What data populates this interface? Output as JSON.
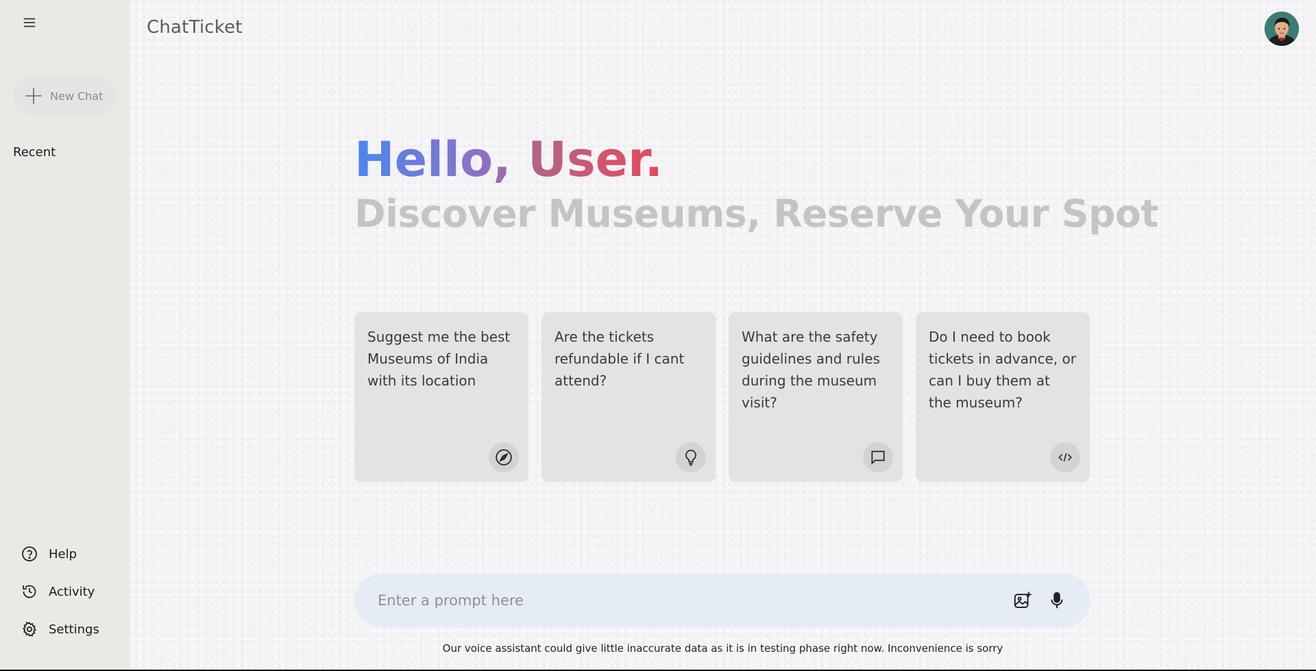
{
  "app": {
    "title": "ChatTicket"
  },
  "sidebar": {
    "new_chat_label": "New Chat",
    "recent_label": "Recent",
    "bottom_items": [
      {
        "label": "Help",
        "icon": "help-circle-icon"
      },
      {
        "label": "Activity",
        "icon": "history-icon"
      },
      {
        "label": "Settings",
        "icon": "gear-icon"
      }
    ]
  },
  "header": {
    "brand": "ChatTicket"
  },
  "greeting": {
    "hello": "Hello, User.",
    "subtitle": "Discover Museums, Reserve Your Spot"
  },
  "cards": [
    {
      "text": "Suggest me the best Museums of India with its location",
      "icon": "compass-icon"
    },
    {
      "text": "Are the tickets refundable if I cant attend?",
      "icon": "lightbulb-icon"
    },
    {
      "text": "What are the safety guidelines and rules during the museum visit?",
      "icon": "chat-bubble-icon"
    },
    {
      "text": "Do I need to book tickets in advance, or can I buy them at the museum?",
      "icon": "code-icon"
    }
  ],
  "prompt": {
    "placeholder": "Enter a prompt here",
    "value": ""
  },
  "disclaimer": "Our voice assistant could give little inaccurate data as it is in testing phase right now. Inconvenience is sorry",
  "colors": {
    "sidebar_bg": "#ebe9e6",
    "card_bg": "#e2e3e5",
    "prompt_bg": "#e6ecf5",
    "gradient_start": "#4b86f0",
    "gradient_end": "#e24a5c",
    "subtitle": "#c4c4c4"
  }
}
